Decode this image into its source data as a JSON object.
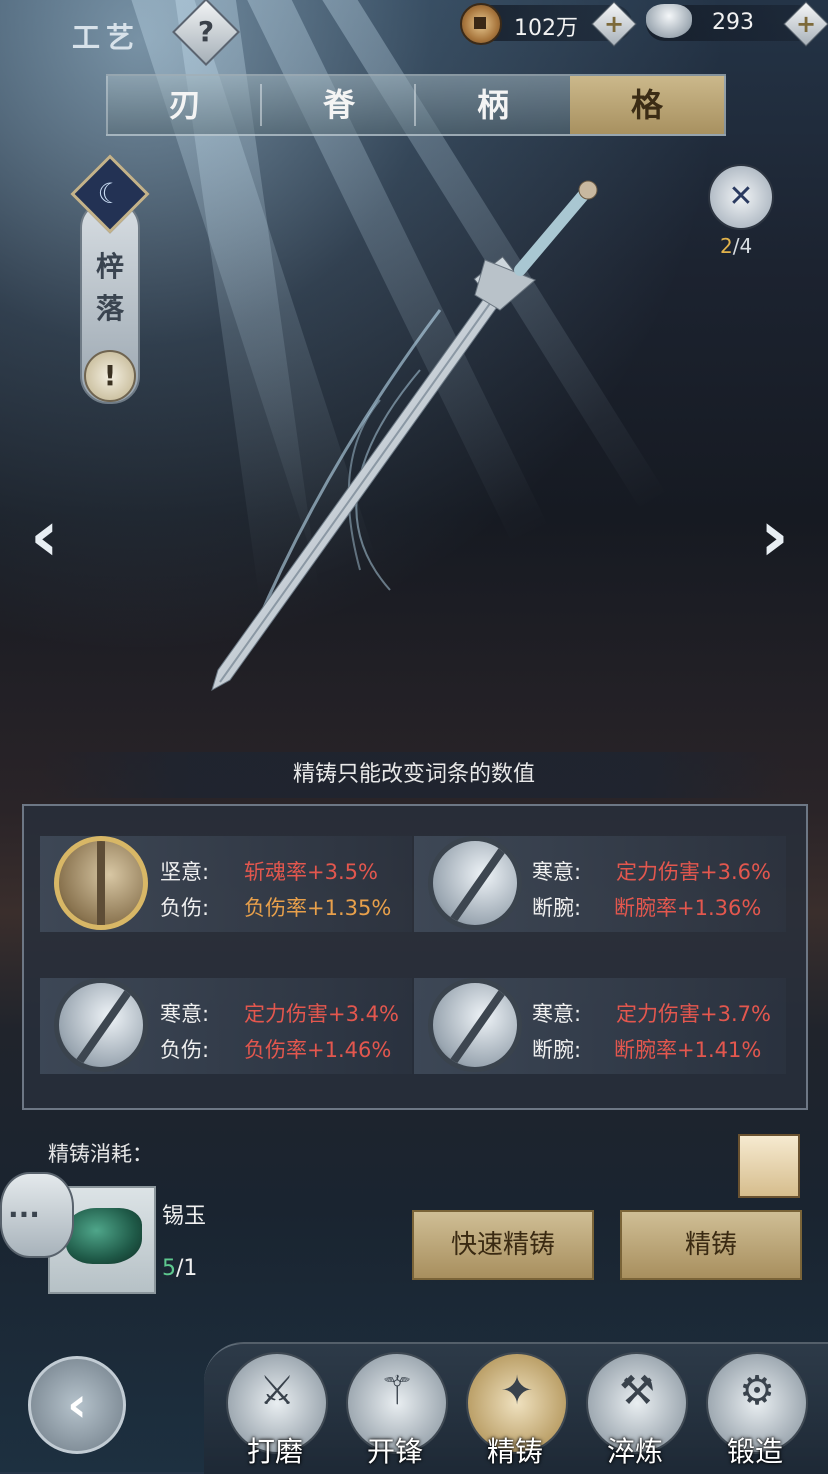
{
  "header": {
    "title": "工艺",
    "help_icon": "question-icon",
    "copper": {
      "icon": "copper-coin-icon",
      "value": "102万"
    },
    "silver": {
      "icon": "silver-ingot-icon",
      "value": "293"
    }
  },
  "tabs": [
    {
      "label": "刃",
      "selected": false
    },
    {
      "label": "脊",
      "selected": false
    },
    {
      "label": "柄",
      "selected": false
    },
    {
      "label": "格",
      "selected": true
    }
  ],
  "weapon": {
    "name": "梓落",
    "badge_count_current": "2",
    "badge_count_sep": "/",
    "badge_count_total": "4"
  },
  "notice": "精铸只能改变词条的数值",
  "stat_cells": [
    {
      "line1_label": "坚意:",
      "line1_value": "斩魂率+3.5%",
      "line2_label": "负伤:",
      "line2_value": "负伤率+1.35%",
      "selected": true
    },
    {
      "line1_label": "寒意:",
      "line1_value": "定力伤害+3.6%",
      "line2_label": "断腕:",
      "line2_value": "断腕率+1.36%",
      "selected": false
    },
    {
      "line1_label": "寒意:",
      "line1_value": "定力伤害+3.4%",
      "line2_label": "负伤:",
      "line2_value": "负伤率+1.46%",
      "selected": false
    },
    {
      "line1_label": "寒意:",
      "line1_value": "定力伤害+3.7%",
      "line2_label": "断腕:",
      "line2_value": "断腕率+1.41%",
      "selected": false
    }
  ],
  "cost": {
    "title": "精铸消耗：",
    "item_name": "锡玉",
    "owned": "5",
    "sep": "/",
    "required": "1"
  },
  "buttons": {
    "quick": "快速精铸",
    "cast": "精铸"
  },
  "bottom_nav": [
    {
      "label": "打磨",
      "icon": "grind-icon",
      "selected": false
    },
    {
      "label": "开锋",
      "icon": "sharpen-icon",
      "selected": false
    },
    {
      "label": "精铸",
      "icon": "refine-icon",
      "selected": true
    },
    {
      "label": "淬炼",
      "icon": "temper-icon",
      "selected": false
    },
    {
      "label": "锻造",
      "icon": "anvil-icon",
      "selected": false
    }
  ],
  "colors": {
    "accent_gold": "#cbb88b",
    "stat_red": "#e3574e",
    "stat_orange": "#e8a04b",
    "count_green": "#5ec98f"
  }
}
